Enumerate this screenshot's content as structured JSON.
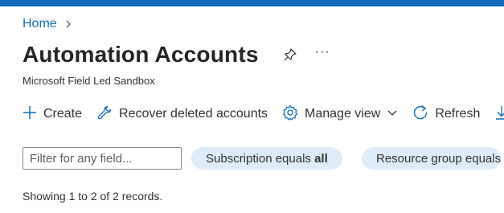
{
  "breadcrumb": {
    "home": "Home"
  },
  "page": {
    "title": "Automation Accounts",
    "more": "···",
    "subtitle": "Microsoft Field Led Sandbox"
  },
  "toolbar": {
    "create": "Create",
    "recover": "Recover deleted accounts",
    "manage_view": "Manage view",
    "refresh": "Refresh"
  },
  "filters": {
    "search_placeholder": "Filter for any field...",
    "subscription_prefix": "Subscription equals ",
    "subscription_value": "all",
    "resource_group_label": "Resource group equals"
  },
  "status": {
    "records": "Showing 1 to 2 of 2 records."
  },
  "colors": {
    "accent": "#0f6cbd",
    "pill_bg": "#deecf9"
  },
  "icons": [
    "chevron-right-icon",
    "pin-icon",
    "more-icon",
    "plus-icon",
    "wrench-icon",
    "gear-icon",
    "chevron-down-icon",
    "refresh-icon",
    "download-icon"
  ]
}
